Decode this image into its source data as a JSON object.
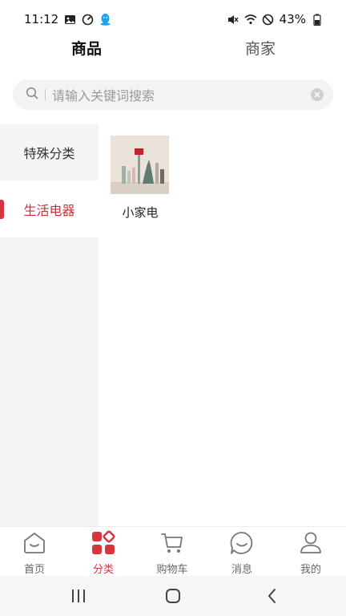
{
  "status_bar": {
    "time": "11:12",
    "battery": "43%"
  },
  "top_tabs": {
    "products": "商品",
    "merchants": "商家"
  },
  "search": {
    "placeholder": "请输入关键词搜索"
  },
  "sidebar": {
    "items": [
      {
        "label": "特殊分类"
      },
      {
        "label": "生活电器"
      }
    ]
  },
  "products": [
    {
      "name": "小家电"
    }
  ],
  "tab_bar": {
    "items": [
      {
        "label": "首页",
        "icon": "home-icon"
      },
      {
        "label": "分类",
        "icon": "category-icon"
      },
      {
        "label": "购物车",
        "icon": "cart-icon"
      },
      {
        "label": "消息",
        "icon": "message-icon"
      },
      {
        "label": "我的",
        "icon": "profile-icon"
      }
    ]
  },
  "colors": {
    "accent": "#d8343e",
    "sidebar_bg": "#f5f5f5",
    "search_bg": "#f3f3f3"
  }
}
